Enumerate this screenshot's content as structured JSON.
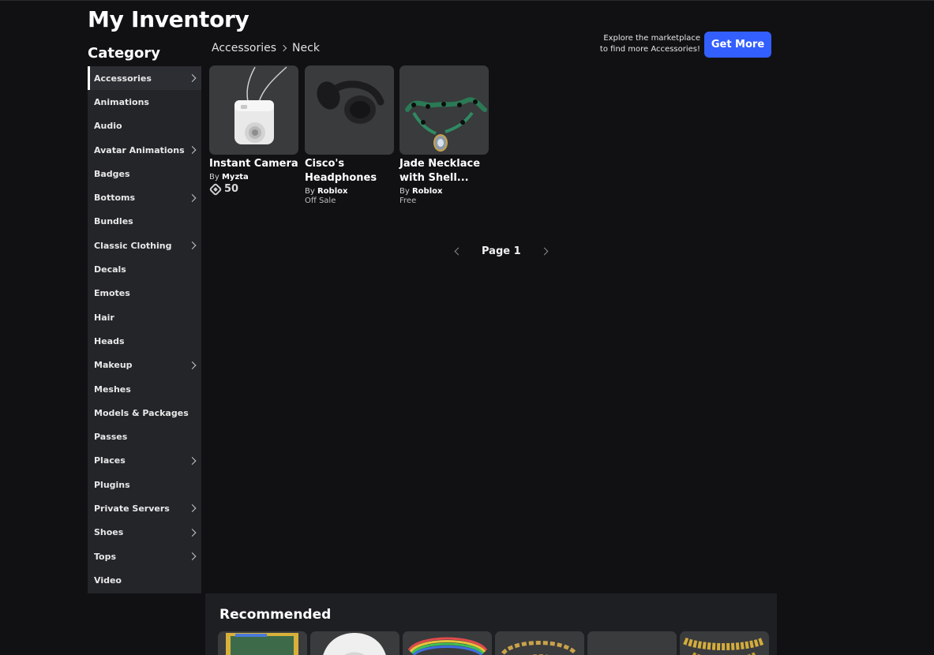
{
  "page": {
    "title": "My Inventory"
  },
  "sidebar": {
    "heading": "Category",
    "items": [
      {
        "label": "Accessories",
        "has_submenu": true,
        "active": true
      },
      {
        "label": "Animations",
        "has_submenu": false
      },
      {
        "label": "Audio",
        "has_submenu": false
      },
      {
        "label": "Avatar Animations",
        "has_submenu": true
      },
      {
        "label": "Badges",
        "has_submenu": false
      },
      {
        "label": "Bottoms",
        "has_submenu": true
      },
      {
        "label": "Bundles",
        "has_submenu": false
      },
      {
        "label": "Classic Clothing",
        "has_submenu": true
      },
      {
        "label": "Decals",
        "has_submenu": false
      },
      {
        "label": "Emotes",
        "has_submenu": false
      },
      {
        "label": "Hair",
        "has_submenu": false
      },
      {
        "label": "Heads",
        "has_submenu": false
      },
      {
        "label": "Makeup",
        "has_submenu": true
      },
      {
        "label": "Meshes",
        "has_submenu": false
      },
      {
        "label": "Models & Packages",
        "has_submenu": false
      },
      {
        "label": "Passes",
        "has_submenu": false
      },
      {
        "label": "Places",
        "has_submenu": true
      },
      {
        "label": "Plugins",
        "has_submenu": false
      },
      {
        "label": "Private Servers",
        "has_submenu": true
      },
      {
        "label": "Shoes",
        "has_submenu": true
      },
      {
        "label": "Tops",
        "has_submenu": true
      },
      {
        "label": "Video",
        "has_submenu": false
      }
    ]
  },
  "breadcrumb": {
    "parent": "Accessories",
    "current": "Neck"
  },
  "explore": {
    "line1": "Explore the marketplace",
    "line2": "to find more Accessories!",
    "button_label": "Get More"
  },
  "items": [
    {
      "name": "Instant Camera",
      "by": "By",
      "creator": "Myzta",
      "price": "50",
      "icon": "robux-icon"
    },
    {
      "name": "Cisco's Headphones",
      "by": "By",
      "creator": "Roblox",
      "price": "Off Sale"
    },
    {
      "name": "Jade Necklace with Shell...",
      "by": "By",
      "creator": "Roblox",
      "price": "Free"
    }
  ],
  "pagination": {
    "label": "Page 1"
  },
  "recommended": {
    "title": "Recommended"
  },
  "colors": {
    "background": "#111114",
    "sidebar": "#232529",
    "accent": "#335fff",
    "tile": "#393b3d"
  }
}
